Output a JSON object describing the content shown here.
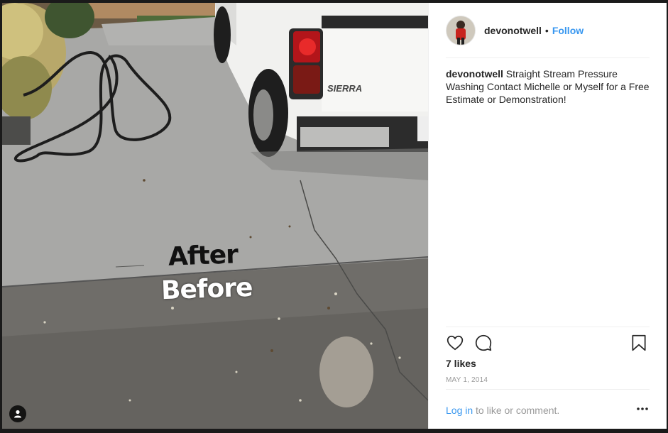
{
  "post": {
    "image_text": {
      "after": "After",
      "before": "Before"
    },
    "truck_badge": "SIERRA"
  },
  "header": {
    "username": "devonotwell",
    "separator": "•",
    "follow_label": "Follow"
  },
  "caption": {
    "username": "devonotwell",
    "text": "Straight Stream Pressure Washing Contact Michelle or Myself for a Free Estimate or Demonstration!"
  },
  "actions": {
    "like_icon": "heart-icon",
    "comment_icon": "comment-icon",
    "save_icon": "bookmark-icon"
  },
  "likes_text": "7 likes",
  "date_text": "MAY 1, 2014",
  "login": {
    "link": "Log in",
    "rest": " to like or comment."
  },
  "more_icon": "ellipsis-icon",
  "colors": {
    "link": "#3897f0",
    "text": "#262626",
    "muted": "#999999"
  }
}
